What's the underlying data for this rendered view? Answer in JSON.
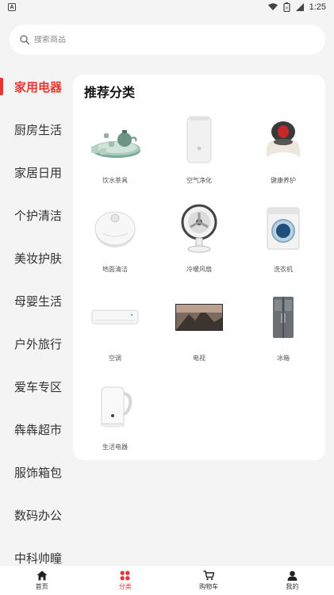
{
  "status_bar": {
    "time": "1:25"
  },
  "search": {
    "placeholder": "搜索商品"
  },
  "sidebar": {
    "items": [
      {
        "label": "家用电器",
        "active": true
      },
      {
        "label": "厨房生活"
      },
      {
        "label": "家居日用"
      },
      {
        "label": "个护清洁"
      },
      {
        "label": "美妆护肤"
      },
      {
        "label": "母婴生活"
      },
      {
        "label": "户外旅行"
      },
      {
        "label": "爱车专区"
      },
      {
        "label": "犇犇超市"
      },
      {
        "label": "服饰箱包"
      },
      {
        "label": "数码办公"
      },
      {
        "label": "中科帅瞳"
      }
    ]
  },
  "content": {
    "title": "推荐分类",
    "categories": [
      {
        "label": "饮水茶具",
        "icon": "tea-set-icon"
      },
      {
        "label": "空气净化",
        "icon": "air-purifier-icon"
      },
      {
        "label": "健康养护",
        "icon": "massager-icon"
      },
      {
        "label": "地面清洁",
        "icon": "robot-vacuum-icon"
      },
      {
        "label": "冷暖风扇",
        "icon": "fan-icon"
      },
      {
        "label": "洗衣机",
        "icon": "washing-machine-icon"
      },
      {
        "label": "空调",
        "icon": "air-conditioner-icon"
      },
      {
        "label": "电视",
        "icon": "tv-icon"
      },
      {
        "label": "冰箱",
        "icon": "fridge-icon"
      },
      {
        "label": "生活电器",
        "icon": "kettle-icon"
      }
    ]
  },
  "bottom_nav": {
    "items": [
      {
        "label": "首页",
        "icon": "home-icon"
      },
      {
        "label": "分类",
        "icon": "category-icon",
        "active": true
      },
      {
        "label": "购物车",
        "icon": "cart-icon"
      },
      {
        "label": "我的",
        "icon": "profile-icon"
      }
    ]
  },
  "colors": {
    "accent": "#e53935",
    "background": "#f4f4f4",
    "card": "#ffffff"
  }
}
